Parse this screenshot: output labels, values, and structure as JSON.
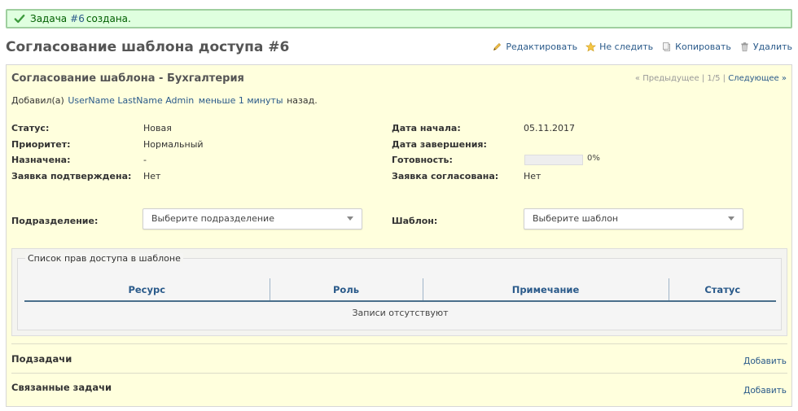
{
  "flash": {
    "prefix": "Задача",
    "issue_link": "#6",
    "suffix": "создана."
  },
  "title": "Согласование шаблона доступа #6",
  "actions": {
    "edit": "Редактировать",
    "unwatch": "Не следить",
    "copy": "Копировать",
    "delete": "Удалить"
  },
  "issue": {
    "subject": "Согласование шаблона - Бухгалтерия",
    "prev": "« Предыдущее",
    "separator": "|",
    "position": "1/5",
    "next": "Следующее »",
    "added_by": "Добавил(а)",
    "author": "UserName LastName Admin",
    "time_ago": "меньше 1 минуты",
    "ago_suffix": "назад.",
    "attributes": {
      "status_label": "Статус:",
      "status": "Новая",
      "priority_label": "Приоритет:",
      "priority": "Нормальный",
      "assigned_label": "Назначена:",
      "assigned": "-",
      "confirmed_label": "Заявка подтверждена:",
      "confirmed": "Нет",
      "start_label": "Дата начала:",
      "start": "05.11.2017",
      "due_label": "Дата завершения:",
      "due": "",
      "done_label": "Готовность:",
      "done": "0%",
      "done_ratio": 0,
      "approved_label": "Заявка согласована:",
      "approved": "Нет"
    },
    "department_label": "Подразделение:",
    "department_placeholder": "Выберите подразделение",
    "template_label": "Шаблон:",
    "template_placeholder": "Выберите шаблон",
    "permissions": {
      "legend": "Список прав доступа в шаблоне",
      "columns": [
        "Ресурс",
        "Роль",
        "Примечание",
        "Статус"
      ],
      "empty": "Записи отсутствуют"
    },
    "subtasks": {
      "title": "Подзадачи",
      "add": "Добавить"
    },
    "relations": {
      "title": "Связанные задачи",
      "add": "Добавить"
    }
  },
  "colors": {
    "notice_bg": "#dfffdf",
    "issue_bg": "#ffffdd",
    "link": "#2a5a8a"
  }
}
